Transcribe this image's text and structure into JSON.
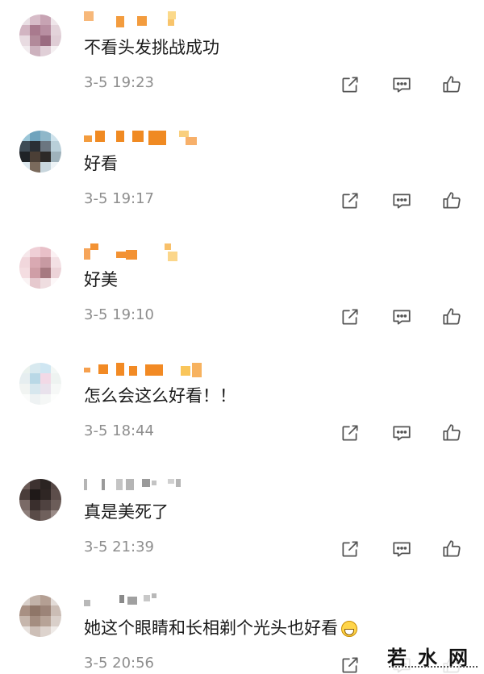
{
  "comments": [
    {
      "text": "不看头发挑战成功",
      "time": "3-5 19:23",
      "avatar_colors": [
        "#e9dfe4",
        "#d7bcc8",
        "#c7a3b3",
        "#efe6ea",
        "#d2b5c2",
        "#a97a8e",
        "#b88ea1",
        "#e3d3da",
        "#e8dbe1",
        "#b28a9a",
        "#9a6b80",
        "#dfcdd5",
        "#f2ecef",
        "#cdb2be",
        "#e0cfd7",
        "#f5f0f2"
      ],
      "name_colors": [
        "#f7b87a",
        "#f39c3e",
        "#f8c46b",
        "#fbd98a"
      ]
    },
    {
      "text": "好看",
      "time": "3-5 19:17",
      "avatar_colors": [
        "#9bc6d8",
        "#6fa3bd",
        "#8fb7c9",
        "#cfe3ec",
        "#3e4b55",
        "#2a2f35",
        "#6b7680",
        "#b9cfd9",
        "#1f2327",
        "#4b3f36",
        "#2d2a28",
        "#9fb2bb",
        "#dde8ee",
        "#7a6a5c",
        "#c8d6dd",
        "#eef4f7"
      ],
      "name_colors": [
        "#f39c3e",
        "#f08a22",
        "#f7b06a",
        "#f9cf7e"
      ]
    },
    {
      "text": "好美",
      "time": "3-5 19:10",
      "avatar_colors": [
        "#f6e7ea",
        "#efcfd6",
        "#e8c0c8",
        "#fbf1f3",
        "#f1d7dc",
        "#d9a9b2",
        "#c79aa2",
        "#f3e0e4",
        "#f4dde1",
        "#cf9ea6",
        "#a67980",
        "#ecd3d8",
        "#faf3f4",
        "#e6c9ce",
        "#efdde0",
        "#fdf8f9"
      ],
      "name_colors": [
        "#f6a55a",
        "#f39233",
        "#f8c06a",
        "#fbd68a"
      ]
    },
    {
      "text": "怎么会这么好看！！",
      "time": "3-5 18:44",
      "avatar_colors": [
        "#eaf2ee",
        "#d8e9ef",
        "#cfe6f2",
        "#f3f7f5",
        "#e6eef0",
        "#b9d8e6",
        "#f2d9e6",
        "#eef3f1",
        "#f1f4f2",
        "#d7e7ee",
        "#e9e2ec",
        "#f6f8f7",
        "#fbfcfb",
        "#eef2f3",
        "#f5f7f6",
        "#fdfefd"
      ],
      "name_colors": [
        "#f6a04e",
        "#f28a24",
        "#f7b25f",
        "#f9c55a"
      ]
    },
    {
      "text": "真是美死了",
      "time": "3-5 21:39",
      "avatar_colors": [
        "#6a5a56",
        "#3d3230",
        "#2b2422",
        "#564845",
        "#4a3d3a",
        "#1f1918",
        "#2f2624",
        "#5d4e4b",
        "#7a6a66",
        "#3a2f2d",
        "#4f4240",
        "#6c5d59",
        "#8d7e7a",
        "#5a4b48",
        "#6f605c",
        "#9a8b87"
      ],
      "name_colors": [
        "#b5b5b5",
        "#9a9a9a",
        "#c4c4c4",
        "#d0d0d0"
      ]
    },
    {
      "text": "她这个眼睛和长相剃个光头也好看",
      "time": "3-5 20:56",
      "avatar_colors": [
        "#d8cfc9",
        "#c2b2a8",
        "#b49f93",
        "#e3dcd8",
        "#a89083",
        "#8f7668",
        "#9c8478",
        "#cbbdb5",
        "#c6b6ac",
        "#a48d80",
        "#b7a397",
        "#d9cfc9",
        "#e7e1dd",
        "#cdbfb7",
        "#ddd3cd",
        "#efebe8"
      ],
      "name_colors": [
        "#a0a0a0",
        "#8a8a8a",
        "#b8b8b8",
        "#c8c8c8"
      ]
    }
  ],
  "icons": {
    "share": "share-icon",
    "reply": "reply-icon",
    "like": "like-icon"
  },
  "watermark": {
    "text": "若水网"
  },
  "colors": {
    "time": "#8e8e8e",
    "icon": "#555555"
  }
}
